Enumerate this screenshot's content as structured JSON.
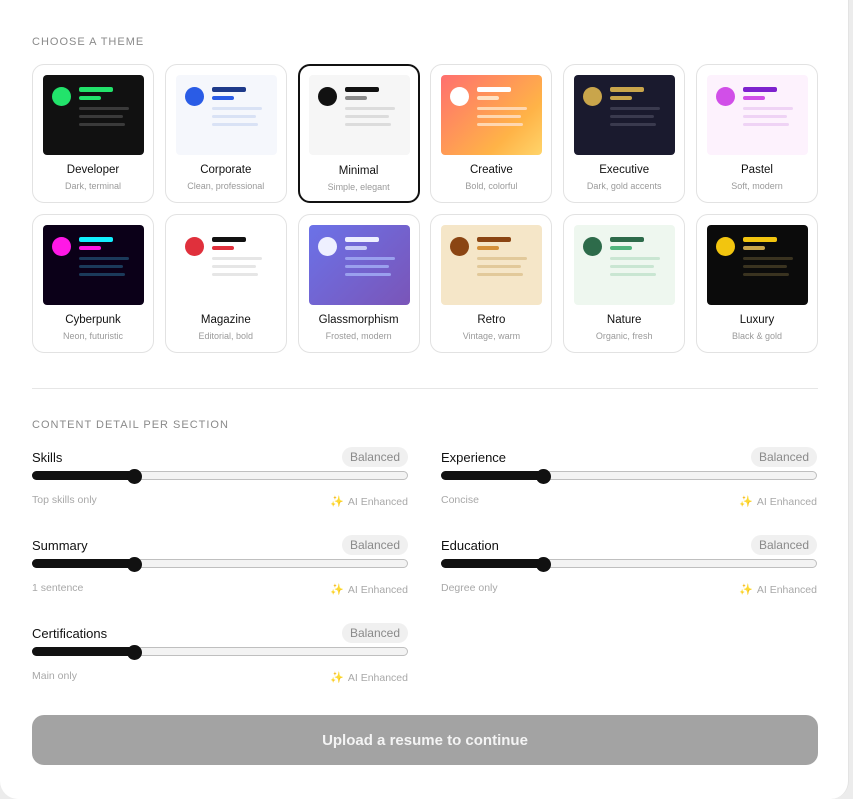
{
  "theme_section": {
    "label": "CHOOSE A THEME",
    "themes": [
      {
        "name": "Developer",
        "desc": "Dark, terminal",
        "bg": "#111111",
        "dot": "#22e36b",
        "l1": "#22e36b",
        "l2": "#22e36b",
        "lines": "#3a3a3a",
        "selected": false
      },
      {
        "name": "Corporate",
        "desc": "Clean, professional",
        "bg": "#f5f7fc",
        "dot": "#2a5ce6",
        "l1": "#1e3a8a",
        "l2": "#2a5ce6",
        "lines": "#d9e2f5",
        "selected": false
      },
      {
        "name": "Minimal",
        "desc": "Simple, elegant",
        "bg": "#f6f6f6",
        "dot": "#111111",
        "l1": "#111111",
        "l2": "#8a8a8a",
        "lines": "#dcdcdc",
        "selected": true
      },
      {
        "name": "Creative",
        "desc": "Bold, colorful",
        "bg": "linear-gradient(135deg,#ff6f6f,#ffb347 70%,#ffd46a)",
        "dot": "#ffffff",
        "l1": "#ffffff",
        "l2": "#ffe2c4",
        "lines": "#ffd7b0",
        "selected": false
      },
      {
        "name": "Executive",
        "desc": "Dark, gold accents",
        "bg": "#1a1a2e",
        "dot": "#c9a54b",
        "l1": "#c9a54b",
        "l2": "#c9a54b",
        "lines": "#3a3a4e",
        "selected": false
      },
      {
        "name": "Pastel",
        "desc": "Soft, modern",
        "bg": "#fdf2fd",
        "dot": "#d14fe8",
        "l1": "#7e22ce",
        "l2": "#d14fe8",
        "lines": "#efd3f5",
        "selected": false
      },
      {
        "name": "Cyberpunk",
        "desc": "Neon, futuristic",
        "bg": "#0b0018",
        "dot": "#ff18e6",
        "l1": "#12f0ff",
        "l2": "#ff18e6",
        "lines": "#1b3a5a",
        "selected": false
      },
      {
        "name": "Magazine",
        "desc": "Editorial, bold",
        "bg": "#ffffff",
        "dot": "#e0303c",
        "l1": "#111111",
        "l2": "#e0303c",
        "lines": "#e6e6e6",
        "selected": false
      },
      {
        "name": "Glassmorphism",
        "desc": "Frosted, modern",
        "bg": "linear-gradient(135deg,#6b72e8,#7a55b8)",
        "dot": "#eef0ff",
        "l1": "#eef0ff",
        "l2": "#c9cdf7",
        "lines": "#9aa0ee",
        "selected": false
      },
      {
        "name": "Retro",
        "desc": "Vintage, warm",
        "bg": "#f5e6c8",
        "dot": "#8b4513",
        "l1": "#8b4513",
        "l2": "#d4903a",
        "lines": "#e2c99a",
        "selected": false
      },
      {
        "name": "Nature",
        "desc": "Organic, fresh",
        "bg": "#eef7ef",
        "dot": "#2d6b4a",
        "l1": "#2d6b4a",
        "l2": "#52b57e",
        "lines": "#c9e6d2",
        "selected": false
      },
      {
        "name": "Luxury",
        "desc": "Black & gold",
        "bg": "#0b0b0b",
        "dot": "#f2c50f",
        "l1": "#f2c50f",
        "l2": "#c9a54b",
        "lines": "#3a3320",
        "selected": false
      }
    ]
  },
  "detail_section": {
    "label": "CONTENT DETAIL PER SECTION",
    "sliders": [
      {
        "title": "Skills",
        "badge": "Balanced",
        "left": "Top skills only",
        "right": "AI Enhanced",
        "level": 0.25
      },
      {
        "title": "Experience",
        "badge": "Balanced",
        "left": "Concise",
        "right": "AI Enhanced",
        "level": 0.25
      },
      {
        "title": "Summary",
        "badge": "Balanced",
        "left": "1 sentence",
        "right": "AI Enhanced",
        "level": 0.25
      },
      {
        "title": "Education",
        "badge": "Balanced",
        "left": "Degree only",
        "right": "AI Enhanced",
        "level": 0.25
      },
      {
        "title": "Certifications",
        "badge": "Balanced",
        "left": "Main only",
        "right": "AI Enhanced",
        "level": 0.25
      }
    ]
  },
  "cta": {
    "label": "Upload a resume to continue"
  }
}
